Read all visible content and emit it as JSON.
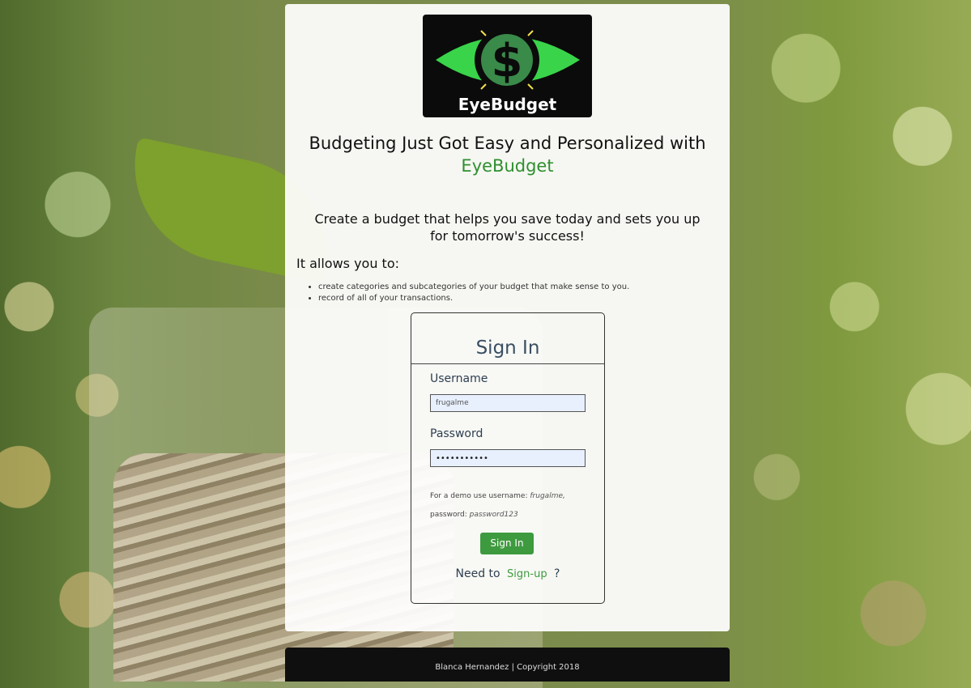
{
  "logo": {
    "text": "EyeBudget",
    "symbol": "$"
  },
  "headline": {
    "line1": "Budgeting Just Got Easy and Personalized with",
    "brand": "EyeBudget"
  },
  "tagline": "Create a budget that helps you save today and sets you up for tomorrow's success!",
  "features": {
    "heading": "It allows you to:",
    "items": [
      "create categories and subcategories of your budget that make sense to you.",
      "record of all of your transactions."
    ]
  },
  "signin": {
    "title": "Sign In",
    "username_label": "Username",
    "username_value": "frugalme",
    "password_label": "Password",
    "password_value": "•••••••••••",
    "demo_prefix": "For a demo use username:",
    "demo_username": "frugalme,",
    "demo_password_prefix": "password:",
    "demo_password": "password123",
    "button": "Sign In",
    "need_to": "Need to",
    "signup_link": "Sign-up",
    "signup_suffix": "?"
  },
  "footer": "Blanca Hernandez | Copyright 2018",
  "colors": {
    "accent": "#3e9a3e",
    "brand_green": "#2f8f2f",
    "logo_green": "#39d44a"
  }
}
